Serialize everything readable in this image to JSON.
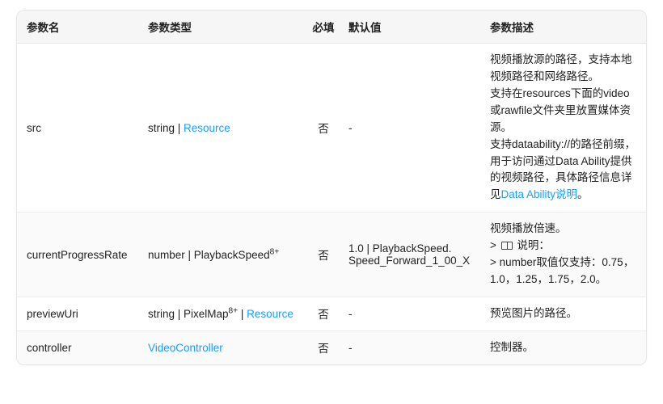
{
  "table": {
    "headers": {
      "name": "参数名",
      "type": "参数类型",
      "required": "必填",
      "default": "默认值",
      "desc": "参数描述"
    },
    "rows": [
      {
        "name": "src",
        "type_prefix": "string | ",
        "type_link": "Resource",
        "type_sup": "",
        "type_suffix": "",
        "required": "否",
        "default": "-",
        "desc": {
          "p1": "视频播放源的路径，支持本地视频路径和网络路径。",
          "p2_a": "支持在resources下面的video或rawfile文件夹里放置媒体资源。",
          "p3_a": "支持dataability://的路径前缀，用于访问通过Data Ability提供的视频路径，具体路径信息详见",
          "p3_link": "Data Ability说明",
          "p3_b": "。"
        }
      },
      {
        "name": "currentProgressRate",
        "type_prefix": "number | PlaybackSpeed",
        "type_link": "",
        "type_sup": "8+",
        "type_suffix": "",
        "required": "否",
        "default": "1.0 | PlaybackSpeed. Speed_Forward_1_00_X",
        "desc": {
          "p1": "视频播放倍速。",
          "note_label": "说明：",
          "p2": "number取值仅支持：0.75，1.0，1.25，1.75，2.0。"
        }
      },
      {
        "name": "previewUri",
        "type_prefix": "string | PixelMap",
        "type_link": "Resource",
        "type_sup": "8+",
        "type_mid": " | ",
        "required": "否",
        "default": "-",
        "desc": {
          "p1": "预览图片的路径。"
        }
      },
      {
        "name": "controller",
        "type_prefix": "",
        "type_link": "VideoController",
        "type_sup": "",
        "type_suffix": "",
        "required": "否",
        "default": "-",
        "desc": {
          "p1": "控制器。"
        }
      }
    ]
  }
}
